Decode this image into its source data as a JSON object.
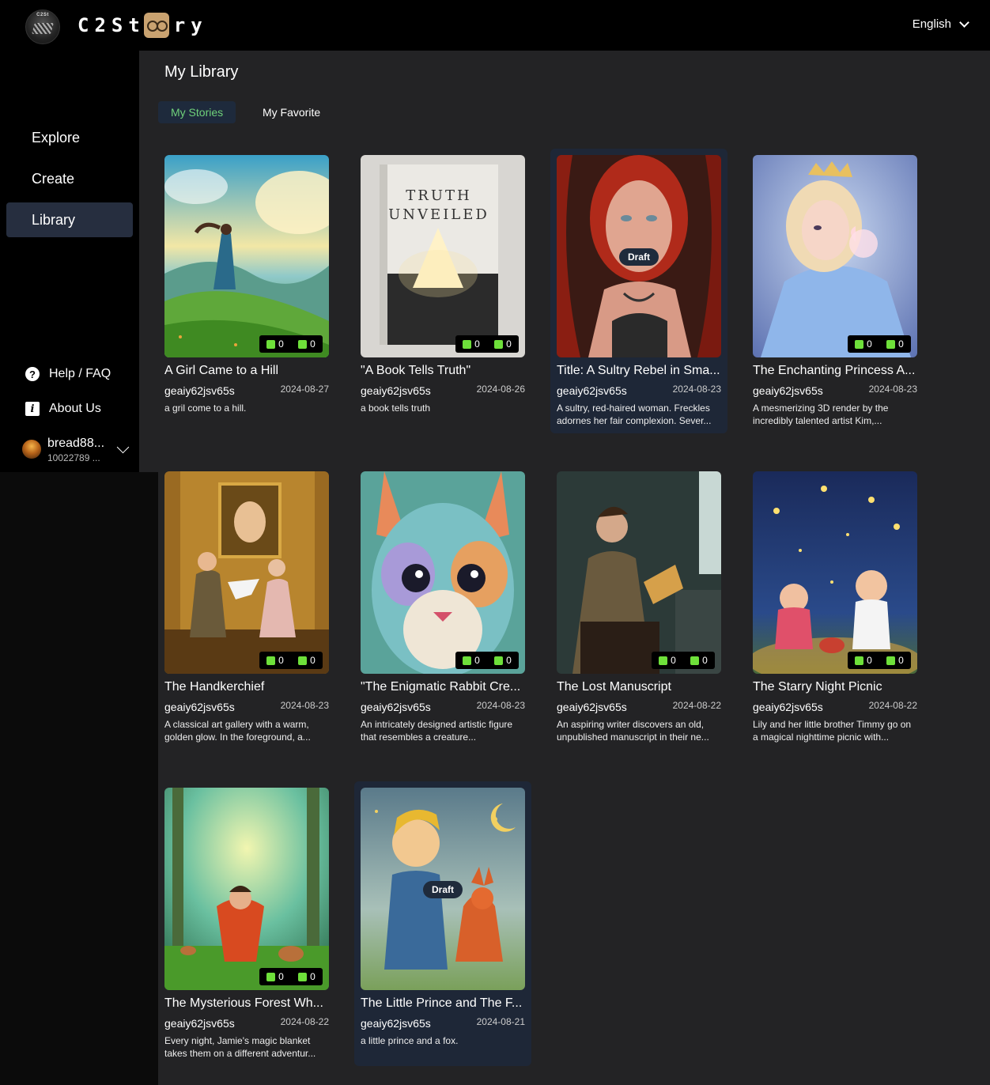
{
  "header": {
    "logo_badge_text": "C2St",
    "logo_text_left": "C2St",
    "logo_text_right": "ry",
    "language": "English"
  },
  "sidebar": {
    "nav": [
      {
        "label": "Explore"
      },
      {
        "label": "Create"
      },
      {
        "label": "Library"
      }
    ],
    "help_label": "Help / FAQ",
    "about_label": "About Us",
    "user": {
      "name": "bread88...",
      "id": "10022789 ..."
    }
  },
  "main": {
    "title": "My Library",
    "tabs": [
      {
        "label": "My Stories",
        "active": true
      },
      {
        "label": "My Favorite",
        "active": false
      }
    ],
    "cards": [
      {
        "title": "A Girl Came to a Hill",
        "author": "geaiy62jsv65s",
        "date": "2024-08-27",
        "desc": "a gril come to a hill.",
        "likes": "0",
        "dislikes": "0",
        "draft": false
      },
      {
        "title": "\"A Book Tells Truth\"",
        "author": "geaiy62jsv65s",
        "date": "2024-08-26",
        "desc": "a book tells truth",
        "likes": "0",
        "dislikes": "0",
        "draft": false,
        "cover_lines": [
          "TRUTH",
          "UNVEILED"
        ]
      },
      {
        "title": "Title: A Sultry Rebel in Sma...",
        "author": "geaiy62jsv65s",
        "date": "2024-08-23",
        "desc": "A sultry, red-haired woman. Freckles adornes her fair complexion. Sever...",
        "draft": true,
        "draft_label": "Draft"
      },
      {
        "title": "The Enchanting Princess A...",
        "author": "geaiy62jsv65s",
        "date": "2024-08-23",
        "desc": "A mesmerizing 3D render by the incredibly talented artist Kim,...",
        "likes": "0",
        "dislikes": "0",
        "draft": false
      },
      {
        "title": "The Handkerchief",
        "author": "geaiy62jsv65s",
        "date": "2024-08-23",
        "desc": "A classical art gallery with a warm, golden glow. In the foreground, a...",
        "likes": "0",
        "dislikes": "0",
        "draft": false
      },
      {
        "title": "\"The Enigmatic Rabbit Cre...",
        "author": "geaiy62jsv65s",
        "date": "2024-08-23",
        "desc": "An intricately designed artistic figure that resembles a creature...",
        "likes": "0",
        "dislikes": "0",
        "draft": false
      },
      {
        "title": "The Lost Manuscript",
        "author": "geaiy62jsv65s",
        "date": "2024-08-22",
        "desc": "An aspiring writer discovers an old, unpublished manuscript in their ne...",
        "likes": "0",
        "dislikes": "0",
        "draft": false
      },
      {
        "title": "The Starry Night Picnic",
        "author": "geaiy62jsv65s",
        "date": "2024-08-22",
        "desc": "Lily and her little brother Timmy go on a magical nighttime picnic with...",
        "likes": "0",
        "dislikes": "0",
        "draft": false
      },
      {
        "title": "The Mysterious Forest Wh...",
        "author": "geaiy62jsv65s",
        "date": "2024-08-22",
        "desc": "Every night, Jamie's magic blanket takes them on a different adventur...",
        "likes": "0",
        "dislikes": "0",
        "draft": false
      },
      {
        "title": "The Little Prince and The F...",
        "author": "geaiy62jsv65s",
        "date": "2024-08-21",
        "desc": "a little prince and a fox.",
        "draft": true,
        "draft_label": "Draft"
      }
    ]
  },
  "colors": {
    "accent_green": "#6fd17a",
    "active_nav_bg": "#262e3f",
    "draft_card_bg": "#1e2737"
  }
}
